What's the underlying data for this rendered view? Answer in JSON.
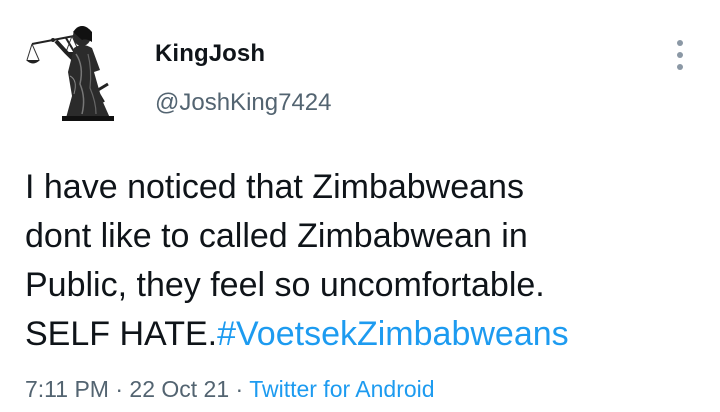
{
  "author": {
    "display_name": "KingJosh",
    "handle": "@JoshKing7424",
    "avatar_icon": "lady-justice-icon"
  },
  "tweet": {
    "lines": [
      "I have noticed that Zimbabweans",
      "dont like to called Zimbabwean in",
      "Public, they feel so uncomfortable."
    ],
    "last_line_prefix": "SELF HATE.",
    "hashtag": "#VoetsekZimbabweans"
  },
  "meta": {
    "time": "7:11 PM",
    "separator": "·",
    "date": "22 Oct 21",
    "source": "Twitter for Android"
  },
  "menu": {
    "icon": "more-vertical-icon"
  },
  "colors": {
    "text": "#0f1419",
    "secondary": "#536471",
    "link": "#1d9bf0"
  }
}
